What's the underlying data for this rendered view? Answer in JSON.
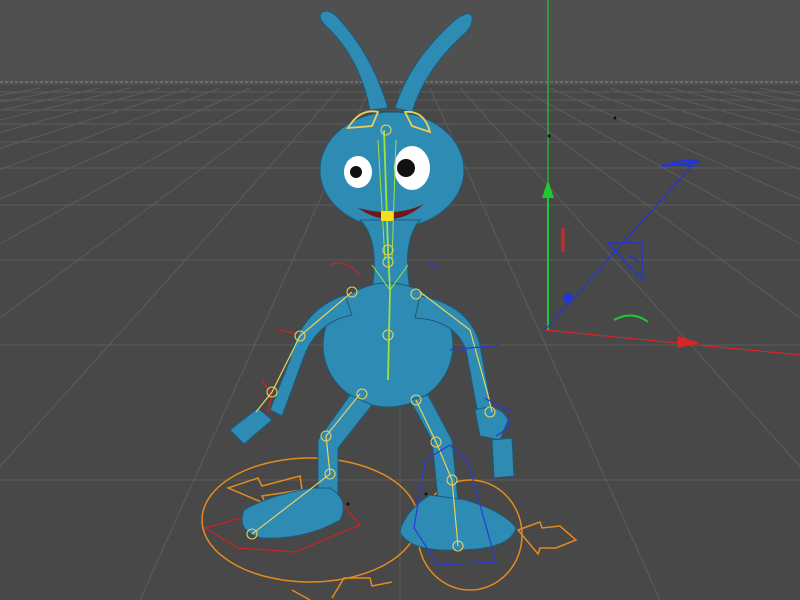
{
  "viewport": {
    "background": "#4b4b4b",
    "sky": "#505050",
    "floor": "#484848",
    "grid_color": "#5c5c5c",
    "horizon_color": "#8a8a8a"
  },
  "axes": {
    "x_color": "#d72626",
    "y_color": "#1fc833",
    "z_color": "#2235d8"
  },
  "character": {
    "body_color": "#2e8bb3",
    "eye_color": "#ffffff",
    "pupil_color": "#111111",
    "mouth_color": "#6e1a1a"
  },
  "rig": {
    "spine_color": "#9ee23c",
    "joint_color": "#e8d060",
    "ik_foot_color": "#e58a1e",
    "ik_arm_color": "#2a3bd8",
    "ik_red_color": "#cc2323"
  }
}
